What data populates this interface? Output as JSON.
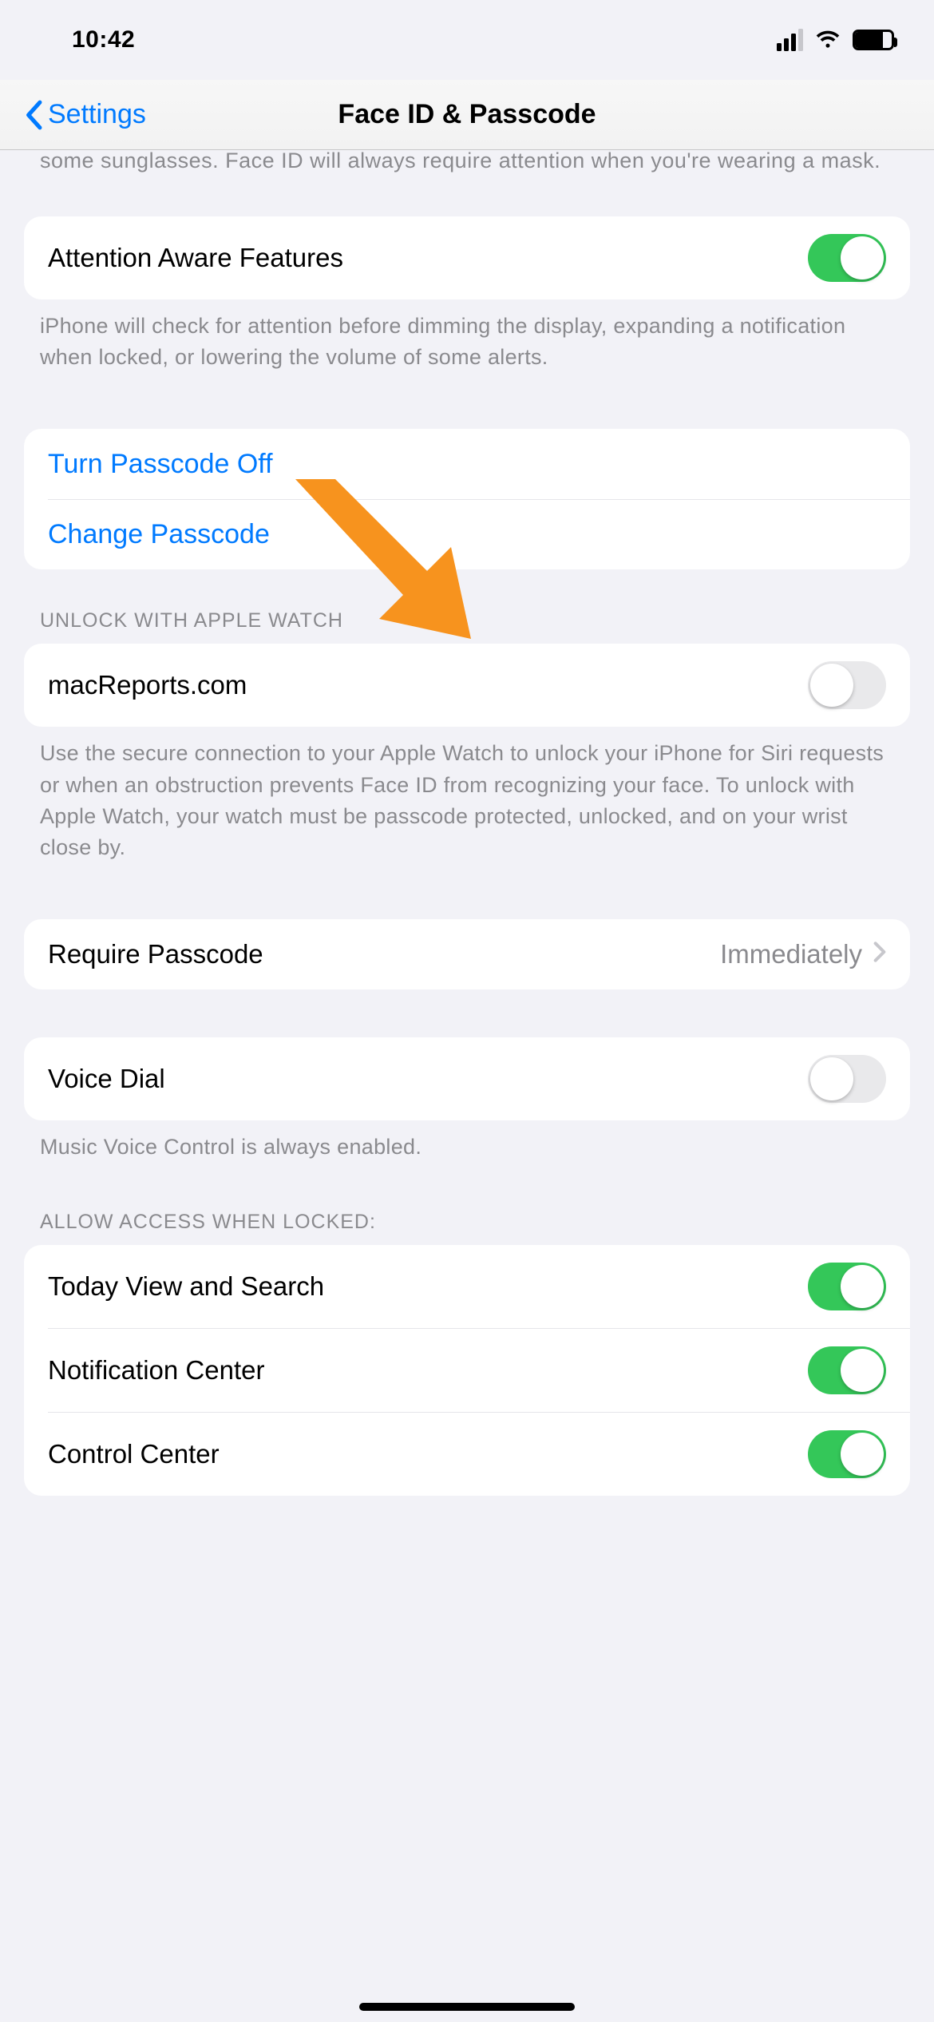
{
  "status": {
    "time": "10:42"
  },
  "nav": {
    "back_label": "Settings",
    "title": "Face ID & Passcode"
  },
  "partial_prev_footer": "some sunglasses. Face ID will always require attention when you're wearing a mask.",
  "attention": {
    "label": "Attention Aware Features",
    "on": true,
    "footer": "iPhone will check for attention before dimming the display, expanding a notification when locked, or lowering the volume of some alerts."
  },
  "passcode": {
    "turn_off": "Turn Passcode Off",
    "change": "Change Passcode"
  },
  "applewatch": {
    "header": "UNLOCK WITH APPLE WATCH",
    "item_label": "macReports.com",
    "item_on": false,
    "footer": "Use the secure connection to your Apple Watch to unlock your iPhone for Siri requests or when an obstruction prevents Face ID from recognizing your face. To unlock with Apple Watch, your watch must be passcode protected, unlocked, and on your wrist close by."
  },
  "require_passcode": {
    "label": "Require Passcode",
    "value": "Immediately"
  },
  "voice_dial": {
    "label": "Voice Dial",
    "on": false,
    "footer": "Music Voice Control is always enabled."
  },
  "allow_locked": {
    "header": "ALLOW ACCESS WHEN LOCKED:",
    "today": {
      "label": "Today View and Search",
      "on": true
    },
    "notif": {
      "label": "Notification Center",
      "on": true
    },
    "control": {
      "label": "Control Center",
      "on": true
    }
  }
}
